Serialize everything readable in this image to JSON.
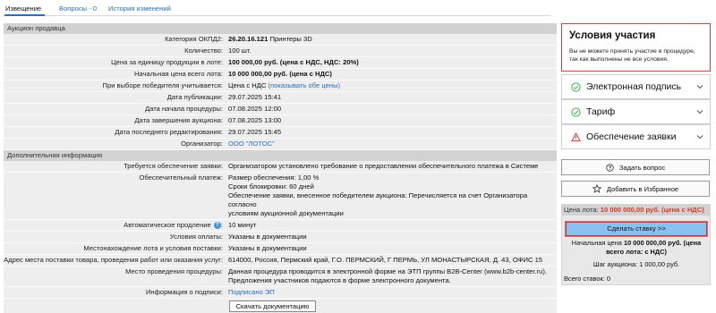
{
  "tabs": [
    {
      "label": "Извещение",
      "active": true
    },
    {
      "label": "Вопросы - 0",
      "active": false
    },
    {
      "label": "История изменений",
      "active": false
    }
  ],
  "auction": {
    "section_title": "Аукцион продавца",
    "okpd_label": "Категория ОКПД2:",
    "okpd_code": "26.20.16.121",
    "okpd_name": "Принтеры 3D",
    "qty_label": "Количество:",
    "qty_value": "100 шт.",
    "unit_price_label": "Цена за единицу продукции в лоте:",
    "unit_price_value": "100 000,00 руб. (цена с НДС, НДС: 20%)",
    "start_price_label": "Начальная цена всего лота:",
    "start_price_value": "10 000 000,00 руб. (цена с НДС)",
    "winner_label": "При выборе победителя учитывается:",
    "winner_value": "Цена с НДС",
    "winner_link": "(показывать обе цены)",
    "pub_date_label": "Дата публикации:",
    "pub_date_value": "29.07.2025 15:41",
    "start_date_label": "Дата начала процедуры:",
    "start_date_value": "07.08.2025 12:00",
    "end_date_label": "Дата завершения аукциона:",
    "end_date_value": "07.08.2025 13:00",
    "edit_date_label": "Дата последнего редактирования:",
    "edit_date_value": "29.07.2025 15:45",
    "organizer_label": "Организатор:",
    "organizer_value": "ООО \"ЛОТОС\""
  },
  "extra": {
    "section_title": "Дополнительная информация",
    "security_req_label": "Требуется обеспечение заявки:",
    "security_req_value": "Организатором установлено требование о предоставлении обеспечительного платежа в Системе",
    "payment_label": "Обеспечительный платеж:",
    "payment_lines": [
      "Размер обеспечения: 1,00 %",
      "Сроки блокировки: 60 дней",
      "Обеспечение заявки, внесенное победителем аукциона: Перечисляется на счет Организатора согласно",
      "условиям аукционной документации"
    ],
    "auto_ext_label": "Автоматическое продление",
    "auto_ext_value": "10 минут",
    "pay_terms_label": "Условия оплаты:",
    "pay_terms_value": "Указаны в документации",
    "location_label": "Местонахождение лота и условия поставки:",
    "location_value": "Указаны в документации",
    "address_label": "Адрес места поставки товара, проведения работ или оказания услуг:",
    "address_value": "614000, Россия, Пермский край, Г.О. ПЕРМСКИЙ, Г ПЕРМЬ, УЛ МОНАСТЫРСКАЯ, Д. 43, ОФИС 15",
    "venue_label": "Место проведения процедуры:",
    "venue_lines": [
      "Данная процедура проводится в электронной форме на ЭТП группы B2B-Center (www.b2b-center.ru).",
      "Предложения участников подаются в форме электронного документа."
    ],
    "sign_label": "Информация о подписи:",
    "sign_value": "Подписано ЭП",
    "download_label": "Скачать документацию"
  },
  "conditions": {
    "title": "Условия участия",
    "text": "Вы не можете принять участие в процедуре, так как выполнены не все условия.",
    "items": [
      {
        "label": "Электронная подпись",
        "icon": "check-circle-icon",
        "color": "#3bb34a"
      },
      {
        "label": "Тариф",
        "icon": "check-circle-icon",
        "color": "#3bb34a"
      },
      {
        "label": "Обеспечение заявки",
        "icon": "warning-triangle-icon",
        "color": "#e0373b"
      }
    ]
  },
  "actions": {
    "ask_label": "Задать вопрос",
    "fav_label": "Добавить в Избранное"
  },
  "bid": {
    "lot_price_label": "Цена лота:",
    "lot_price_value": "10 000 000,00 руб. (цена с НДС)",
    "bid_button": "Сделать ставку >>",
    "init_price_label": "Начальная цена",
    "init_price_value": "10 000 000,00 руб. (цена всего лота: с НДС)",
    "step_label": "Шаг аукциона:",
    "step_value": "1 000,00 руб.",
    "total_label": "Всего ставок:",
    "total_value": "0"
  },
  "colors": {
    "link": "#2a6ec0",
    "accent_red": "#e0373b",
    "ok_green": "#3bb34a",
    "bid_button": "#87c1ef"
  }
}
